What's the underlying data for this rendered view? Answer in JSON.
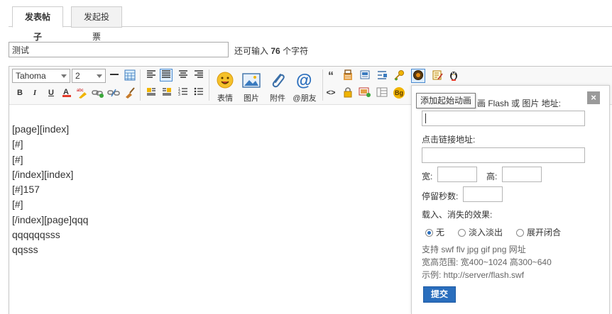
{
  "tabs": [
    {
      "label": "发表帖子",
      "active": true
    },
    {
      "label": "发起投票",
      "active": false
    }
  ],
  "subject": {
    "value": "测试"
  },
  "remaining": {
    "prefix": "还可输入",
    "count": "76",
    "suffix": "个字符"
  },
  "toolbar": {
    "font": "Tahoma",
    "size": "2",
    "bold": "B",
    "italic": "I",
    "underline": "U",
    "quote": "“",
    "code": "<>",
    "bg": "Bg",
    "emoji_label": "表情",
    "image_label": "图片",
    "attach_label": "附件",
    "mention_label": "@朋友"
  },
  "content": [
    "[page][index]",
    "[#]",
    "[#]",
    "[/index][index]",
    "[#]157",
    "[#]",
    "[/index][page]qqq",
    "qqqqqqsss",
    "qqsss"
  ],
  "tooltip": "添加起始动画",
  "popup": {
    "title_tail": "画 Flash 或 图片 地址:",
    "link_label": "点击链接地址:",
    "width_label": "宽:",
    "height_label": "高:",
    "stay_label": "停留秒数:",
    "effect_label": "载入、消失的效果:",
    "options": [
      "无",
      "淡入淡出",
      "展开闭合"
    ],
    "selected": 0,
    "info": [
      "支持 swf flv jpg gif png 网址",
      "宽高范围: 宽400~1024 高300~640",
      "示例: http://server/flash.swf"
    ],
    "submit": "提交",
    "close": "×"
  },
  "colors": {
    "accent": "#2a6ebd",
    "border": "#cdcdcd"
  }
}
